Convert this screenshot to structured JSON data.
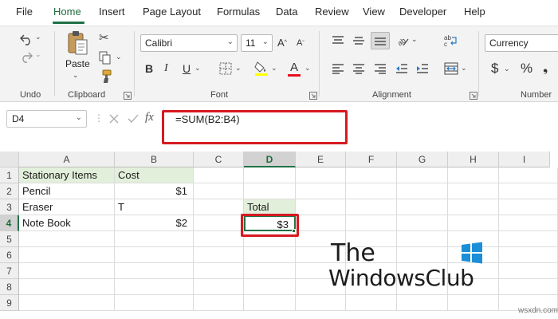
{
  "menu": {
    "tabs": [
      "File",
      "Home",
      "Insert",
      "Page Layout",
      "Formulas",
      "Data",
      "Review",
      "View",
      "Developer",
      "Help"
    ],
    "active_tab": "Home"
  },
  "ribbon": {
    "undo_group_label": "Undo",
    "clipboard": {
      "label": "Clipboard",
      "paste_label": "Paste"
    },
    "font": {
      "label": "Font",
      "family": "Calibri",
      "size": "11",
      "bold": "B",
      "italic": "I",
      "underline": "U",
      "font_color_glyph": "A"
    },
    "alignment": {
      "label": "Alignment"
    },
    "number": {
      "label": "Number",
      "format": "Currency",
      "currency_glyph": "$",
      "percent_glyph": "%"
    }
  },
  "formula_bar": {
    "name_box": "D4",
    "fx_label": "fx",
    "formula": "=SUM(B2:B4)"
  },
  "sheet": {
    "columns": [
      "A",
      "B",
      "C",
      "D",
      "E",
      "F",
      "G",
      "H",
      "I"
    ],
    "selected_column": "D",
    "rows": [
      "1",
      "2",
      "3",
      "4",
      "5",
      "6",
      "7",
      "8",
      "9"
    ],
    "selected_row": "4",
    "cells": {
      "A1": "Stationary Items",
      "B1": "Cost",
      "A2": "Pencil",
      "B2": "$1",
      "A3": "Eraser",
      "B3": "T",
      "D3": "Total",
      "A4": "Note Book",
      "B4": "$2",
      "D4": "$3"
    },
    "active_cell": "D4"
  },
  "colors": {
    "accent_green": "#217346",
    "highlight_red": "#d71920",
    "cell_fill_green": "#e2efda"
  },
  "watermark": {
    "line1": "The",
    "line2": "WindowsClub"
  },
  "site_mark": "wsxdn.com"
}
